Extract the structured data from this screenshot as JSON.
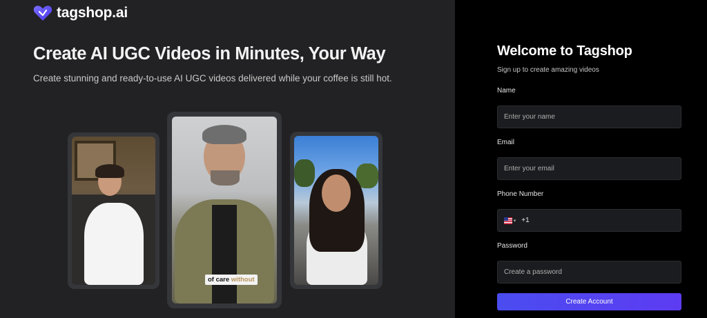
{
  "brand": {
    "name": "tagshop.ai",
    "logo_icon": "heart-logo-icon",
    "accent": "#5a4cf0"
  },
  "hero": {
    "title": "Create AI UGC Videos in Minutes, Your Way",
    "subtitle": "Create stunning and ready-to-use AI UGC videos delivered while your coffee is still hot."
  },
  "video_cards": {
    "center_caption": {
      "text": "of care ",
      "highlight": "without"
    }
  },
  "signup": {
    "title": "Welcome to Tagshop",
    "subtitle": "Sign up to create amazing videos",
    "name_label": "Name",
    "name_placeholder": "Enter your name",
    "email_label": "Email",
    "email_placeholder": "Enter your email",
    "phone_label": "Phone Number",
    "phone_country_icon": "us-flag-icon",
    "phone_code": "+1",
    "password_label": "Password",
    "password_placeholder": "Create a password",
    "submit_label": "Create Account"
  }
}
